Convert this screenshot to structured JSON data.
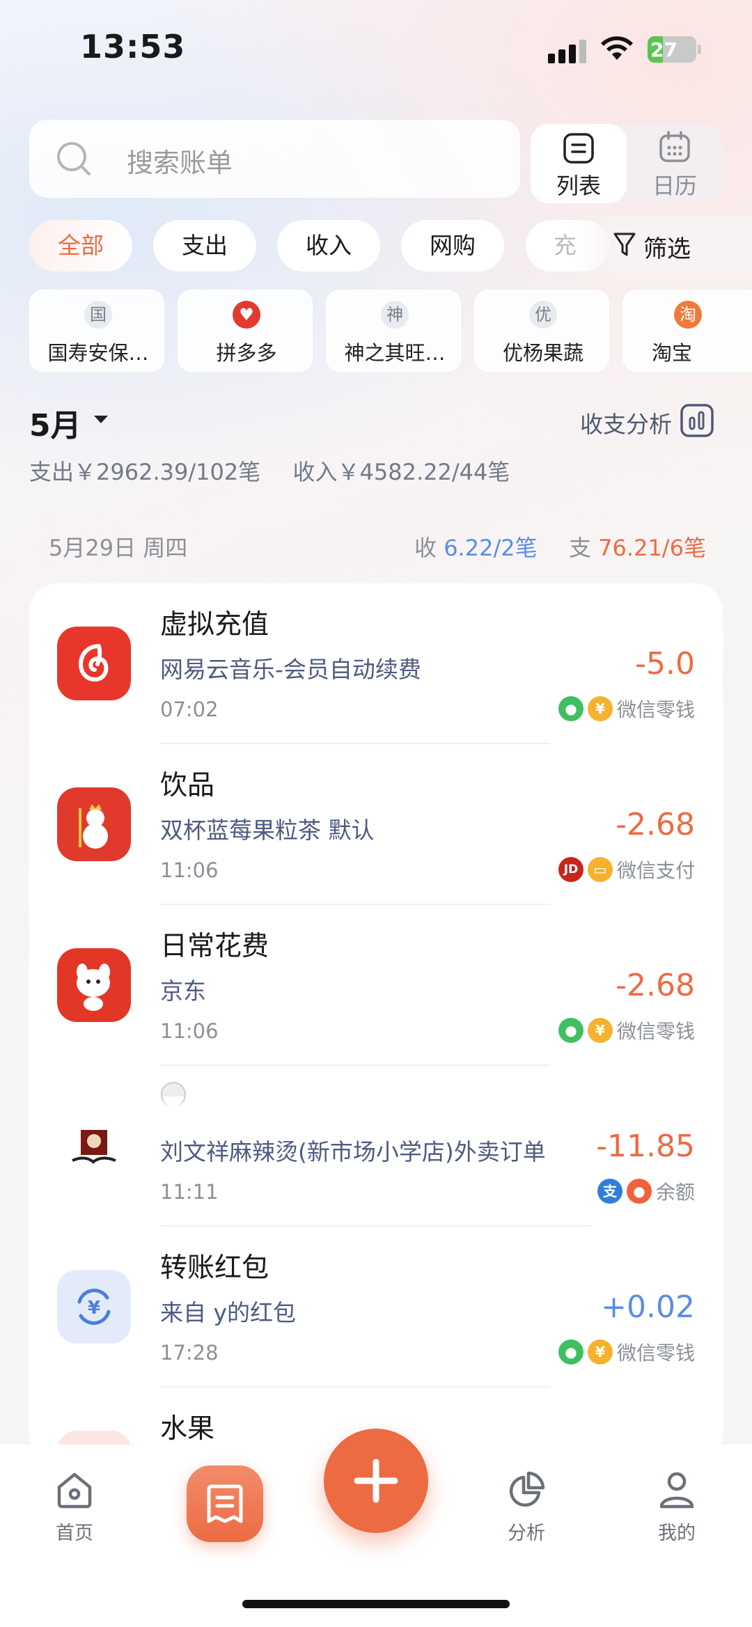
{
  "status_bar": {
    "time": "13:53",
    "battery": "27"
  },
  "search": {
    "placeholder": "搜索账单"
  },
  "view_toggle": {
    "list_label": "列表",
    "calendar_label": "日历"
  },
  "filters": {
    "tabs": [
      "全部",
      "支出",
      "收入",
      "网购",
      "充"
    ],
    "filter_label": "筛选"
  },
  "merchants": [
    {
      "avatar": "国",
      "name": "国寿安保…"
    },
    {
      "avatar": "",
      "name": "拼多多"
    },
    {
      "avatar": "神",
      "name": "神之其旺…"
    },
    {
      "avatar": "优",
      "name": "优杨果蔬"
    },
    {
      "avatar": "淘",
      "name": "淘宝"
    }
  ],
  "month": {
    "label": "5月",
    "analysis_label": "收支分析",
    "summary_out": "支出￥2962.39/102笔",
    "summary_in": "收入￥4582.22/44笔"
  },
  "day": {
    "date": "5月29日 周四",
    "in_prefix": "收",
    "in_value": "6.22/2笔",
    "out_prefix": "支",
    "out_value": "76.21/6笔"
  },
  "transactions": [
    {
      "category": "虚拟充值",
      "desc": "网易云音乐-会员自动续费",
      "time": "07:02",
      "amount": "-5.0",
      "pay": "微信零钱",
      "icon": "netease-music-icon"
    },
    {
      "category": "饮品",
      "desc": "双杯蓝莓果粒茶 默认",
      "time": "11:06",
      "amount": "-2.68",
      "pay": "微信支付",
      "icon": "mixue-icon"
    },
    {
      "category": "日常花费",
      "desc": "京东",
      "time": "11:06",
      "amount": "-2.68",
      "pay": "微信零钱",
      "icon": "jd-icon"
    },
    {
      "category": "",
      "desc": "刘文祥麻辣烫(新市场小学店)外卖订单",
      "time": "11:11",
      "amount": "-11.85",
      "pay": "余额",
      "icon": "liuwenxiang-logo-icon"
    },
    {
      "category": "转账红包",
      "desc": "来自 y的红包",
      "time": "17:28",
      "amount": "+0.02",
      "pay": "微信零钱",
      "icon": "transfer-icon"
    },
    {
      "category": "水果",
      "desc": "",
      "time": "",
      "amount": "",
      "pay": "",
      "icon": "fruit-icon"
    }
  ],
  "nav": {
    "home": "首页",
    "analysis": "分析",
    "mine": "我的"
  },
  "colors": {
    "accent": "#ec6b43",
    "income": "#5a8de6",
    "muted": "#8b8f97"
  }
}
